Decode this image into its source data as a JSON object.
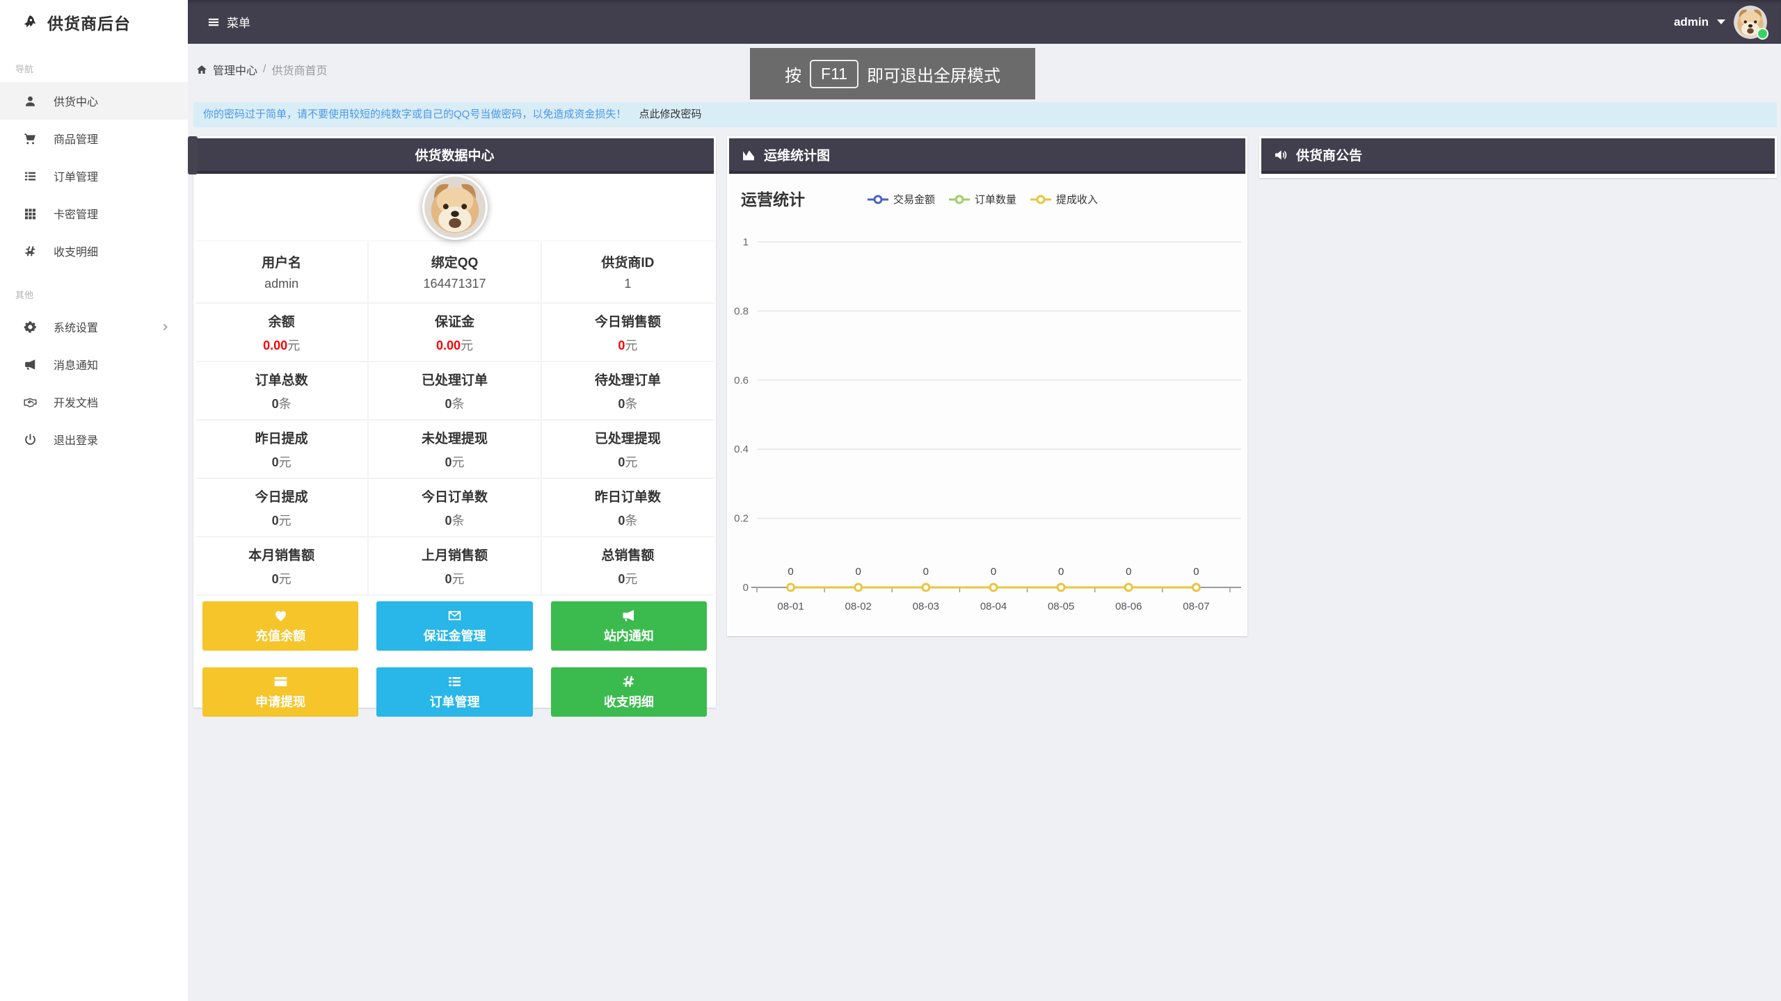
{
  "app": {
    "title": "供货商后台",
    "menu_label": "菜单",
    "user": "admin"
  },
  "breadcrumb": {
    "home": "管理中心",
    "separator": "/",
    "current": "供货商首页"
  },
  "fullscreen_toast": {
    "prefix": "按",
    "key": "F11",
    "suffix": "即可退出全屏模式"
  },
  "alert": {
    "message": "你的密码过于简单，请不要使用较短的纯数字或自己的QQ号当做密码，以免造成资金损失！",
    "link": "点此修改密码"
  },
  "sidebar": {
    "sections": [
      {
        "label": "导航",
        "items": [
          {
            "icon": "user",
            "name": "supply-center",
            "label": "供货中心",
            "active": true
          },
          {
            "icon": "cart",
            "name": "product-management",
            "label": "商品管理"
          },
          {
            "icon": "list",
            "name": "order-management",
            "label": "订单管理"
          },
          {
            "icon": "grid",
            "name": "card-secret-management",
            "label": "卡密管理"
          },
          {
            "icon": "hash",
            "name": "income-expense-detail",
            "label": "收支明细"
          }
        ]
      },
      {
        "label": "其他",
        "items": [
          {
            "icon": "gear",
            "name": "system-settings",
            "label": "系统设置",
            "chevron": true
          },
          {
            "icon": "bullhorn",
            "name": "message-notification",
            "label": "消息通知"
          },
          {
            "icon": "handshake",
            "name": "dev-docs",
            "label": "开发文档"
          },
          {
            "icon": "power",
            "name": "logout",
            "label": "退出登录"
          }
        ]
      }
    ]
  },
  "panels": {
    "data_center": {
      "title": "供货数据中心"
    },
    "chart": {
      "title": "运维统计图"
    },
    "notice": {
      "title": "供货商公告"
    }
  },
  "stats": {
    "rows": [
      [
        {
          "label": "用户名",
          "value": "admin"
        },
        {
          "label": "绑定QQ",
          "value": "164471317"
        },
        {
          "label": "供货商ID",
          "value": "1"
        }
      ],
      [
        {
          "label": "余额",
          "value": "0.00",
          "unit": "元",
          "highlight": true
        },
        {
          "label": "保证金",
          "value": "0.00",
          "unit": "元",
          "highlight": true
        },
        {
          "label": "今日销售额",
          "value": "0",
          "unit": "元",
          "highlight": true
        }
      ],
      [
        {
          "label": "订单总数",
          "value": "0",
          "unit": "条"
        },
        {
          "label": "已处理订单",
          "value": "0",
          "unit": "条"
        },
        {
          "label": "待处理订单",
          "value": "0",
          "unit": "条"
        }
      ],
      [
        {
          "label": "昨日提成",
          "value": "0",
          "unit": "元"
        },
        {
          "label": "未处理提现",
          "value": "0",
          "unit": "元"
        },
        {
          "label": "已处理提现",
          "value": "0",
          "unit": "元"
        }
      ],
      [
        {
          "label": "今日提成",
          "value": "0",
          "unit": "元"
        },
        {
          "label": "今日订单数",
          "value": "0",
          "unit": "条"
        },
        {
          "label": "昨日订单数",
          "value": "0",
          "unit": "条"
        }
      ],
      [
        {
          "label": "本月销售额",
          "value": "0",
          "unit": "元"
        },
        {
          "label": "上月销售额",
          "value": "0",
          "unit": "元"
        },
        {
          "label": "总销售额",
          "value": "0",
          "unit": "元"
        }
      ]
    ]
  },
  "actions": [
    {
      "label": "充值余额",
      "color": "#f5c52a",
      "icon": "heart",
      "name": "recharge-balance"
    },
    {
      "label": "保证金管理",
      "color": "#29b6e8",
      "icon": "envelope",
      "name": "deposit-management"
    },
    {
      "label": "站内通知",
      "color": "#3bbb4e",
      "icon": "bullhorn",
      "name": "site-notice"
    },
    {
      "label": "申请提现",
      "color": "#f5c52a",
      "icon": "card",
      "name": "apply-withdraw"
    },
    {
      "label": "订单管理",
      "color": "#29b6e8",
      "icon": "list",
      "name": "order-management"
    },
    {
      "label": "收支明细",
      "color": "#3bbb4e",
      "icon": "hash",
      "name": "income-expense-detail"
    }
  ],
  "chart_data": {
    "type": "line",
    "title": "运营统计",
    "categories": [
      "08-01",
      "08-02",
      "08-03",
      "08-04",
      "08-05",
      "08-06",
      "08-07"
    ],
    "series": [
      {
        "name": "交易金额",
        "color": "#4a63c8",
        "values": [
          0,
          0,
          0,
          0,
          0,
          0,
          0
        ]
      },
      {
        "name": "订单数量",
        "color": "#9fce63",
        "values": [
          0,
          0,
          0,
          0,
          0,
          0,
          0
        ]
      },
      {
        "name": "提成收入",
        "color": "#e9c53d",
        "values": [
          0,
          0,
          0,
          0,
          0,
          0,
          0
        ]
      }
    ],
    "ylim": [
      0,
      1
    ],
    "yticks": [
      0,
      0.2,
      0.4,
      0.6,
      0.8,
      1
    ],
    "point_labels": [
      "0",
      "0",
      "0",
      "0",
      "0",
      "0",
      "0"
    ],
    "grid": true,
    "legend_position": "top",
    "xlabel": "",
    "ylabel": ""
  },
  "colors": {
    "theme_dark": "#413f4e",
    "header_border": "#312f3e",
    "page_bg": "#eef0f4",
    "alert_bg": "#d9edf7",
    "alert_text": "#4a97e8",
    "red_value": "#ff0000",
    "status_dot": "#35d45f"
  }
}
